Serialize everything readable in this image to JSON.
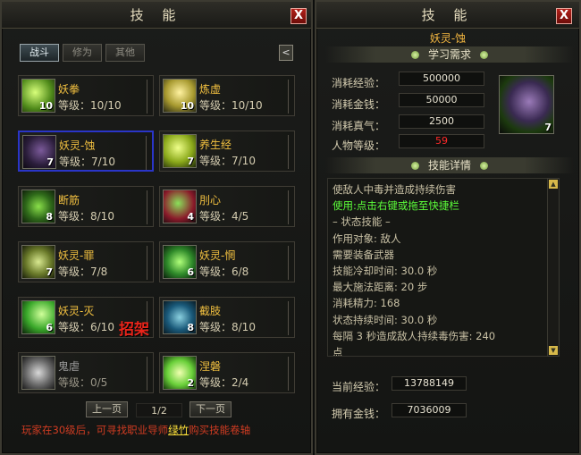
{
  "left": {
    "title": "技 能",
    "close": "X",
    "tabs": [
      "战斗",
      "修为",
      "其他"
    ],
    "back": "<",
    "skills": [
      {
        "name": "妖拳",
        "level_text": "等级：10/10",
        "badge": "10",
        "color": "#7fc33a"
      },
      {
        "name": "炼虚",
        "level_text": "等级：10/10",
        "badge": "10",
        "color": "#c3b43a"
      },
      {
        "name": "妖灵-蚀",
        "level_text": "等级：7/10",
        "badge": "7",
        "color": "#4a3760"
      },
      {
        "name": "养生经",
        "level_text": "等级：7/10",
        "badge": "7",
        "color": "#a9c830"
      },
      {
        "name": "断筋",
        "level_text": "等级：8/10",
        "badge": "8",
        "color": "#4c9a2a"
      },
      {
        "name": "刖心",
        "level_text": "等级：4/5",
        "badge": "4",
        "color": "#3b5a2a"
      },
      {
        "name": "妖灵-罪",
        "level_text": "等级：7/8",
        "badge": "7",
        "color": "#8a8f3a"
      },
      {
        "name": "妖灵-惘",
        "level_text": "等级：6/8",
        "badge": "6",
        "color": "#3a8a3a"
      },
      {
        "name": "妖灵-灭",
        "level_text": "等级：6/10",
        "badge": "6",
        "color": "#4bb33a"
      },
      {
        "name": "截肢",
        "level_text": "等级：8/10",
        "badge": "8",
        "color": "#2a6a8a"
      },
      {
        "name": "鬼虐",
        "level_text": "等级：0/5",
        "badge": "",
        "color": "#777777"
      },
      {
        "name": "涅磐",
        "level_text": "等级：2/4",
        "badge": "2",
        "color": "#6ad03a"
      }
    ],
    "block_label": "招架",
    "prev_page": "上一页",
    "page": "1/2",
    "next_page": "下一页",
    "tip_before": "玩家在30级后，可寻找职业导师",
    "tip_link": "绿竹",
    "tip_after": "购买技能卷轴"
  },
  "right": {
    "title": "技 能",
    "close": "X",
    "skill_name": "妖灵-蚀",
    "requirements_header": "学习需求",
    "exp_label": "消耗经验：",
    "exp_value": "500000",
    "money_label": "消耗金钱：",
    "money_value": "50000",
    "qi_label": "消耗真气：",
    "qi_value": "2500",
    "level_label": "人物等级：",
    "level_value": "59",
    "icon_badge": "7",
    "details_header": "技能详情",
    "desc_lines": [
      "使敌人中毒并造成持续伤害",
      "使用:点击右键或拖至快捷栏",
      "–    状态技能  –",
      "作用对象: 敌人",
      "需要装备武器",
      "技能冷却时间: 30.0 秒",
      "最大施法距离: 20 步",
      "消耗精力: 168",
      "状态持续时间: 30.0 秒",
      "每隔 3 秒造成敌人持续毒伤害: 240",
      "点"
    ],
    "cur_exp_label": "当前经验：",
    "cur_exp_value": "13788149",
    "gold_label": "拥有金钱：",
    "gold_value": "7036009"
  }
}
